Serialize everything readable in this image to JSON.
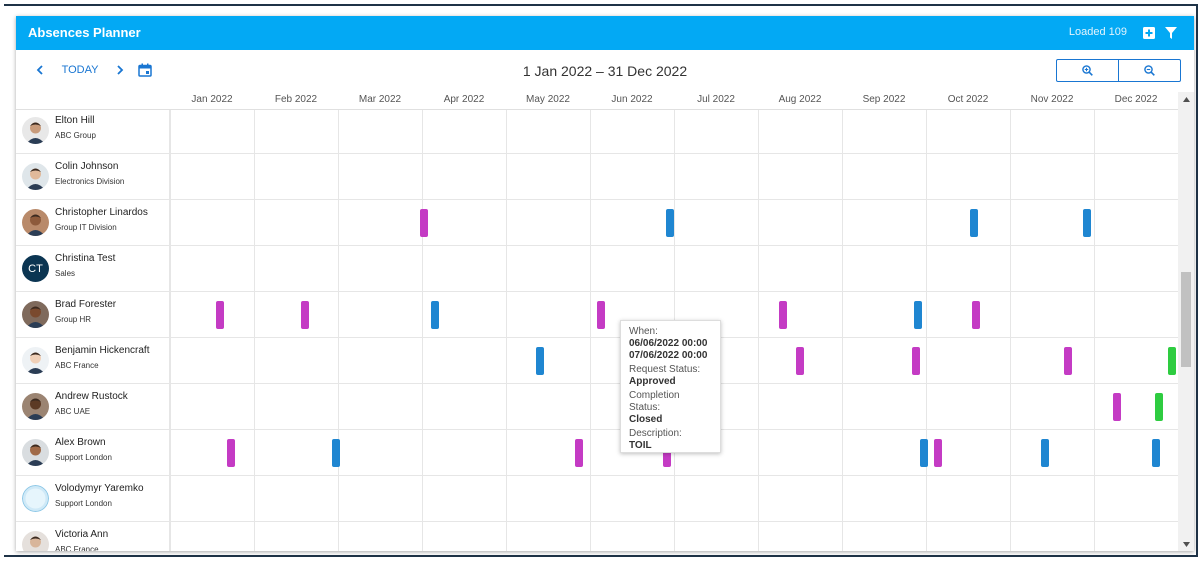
{
  "app": {
    "title": "Absences Planner",
    "loaded_text": "Loaded 109"
  },
  "toolbar": {
    "today_label": "TODAY",
    "date_range": "1 Jan 2022 – 31 Dec 2022"
  },
  "months": [
    "Jan 2022",
    "Feb 2022",
    "Mar 2022",
    "Apr 2022",
    "May 2022",
    "Jun 2022",
    "Jul 2022",
    "Aug 2022",
    "Sep 2022",
    "Oct 2022",
    "Nov 2022",
    "Dec 2022"
  ],
  "colors": {
    "header": "#03a9f4",
    "accent": "#1976d2",
    "magenta": "#c43bc4",
    "blue": "#1f86d1",
    "green": "#2ecc40"
  },
  "people": [
    {
      "name": "Elton Hill",
      "group": "ABC Group",
      "avatar": "photo"
    },
    {
      "name": "Colin Johnson",
      "group": "Electronics Division",
      "avatar": "photo"
    },
    {
      "name": "Christopher Linardos",
      "group": "Group IT Division",
      "avatar": "photo"
    },
    {
      "name": "Christina Test",
      "group": "Sales",
      "avatar": "initials",
      "initials": "CT"
    },
    {
      "name": "Brad Forester",
      "group": "Group HR",
      "avatar": "photo"
    },
    {
      "name": "Benjamin Hickencraft",
      "group": "ABC France",
      "avatar": "photo"
    },
    {
      "name": "Andrew Rustock",
      "group": "ABC UAE",
      "avatar": "photo"
    },
    {
      "name": "Alex Brown",
      "group": "Support London",
      "avatar": "photo"
    },
    {
      "name": "Volodymyr Yaremko",
      "group": "Support London",
      "avatar": "placeholder"
    },
    {
      "name": "Victoria Ann",
      "group": "ABC France",
      "avatar": "photo"
    }
  ],
  "absences": [
    {
      "row": 2,
      "date": "2022-04-03",
      "color": "magenta"
    },
    {
      "row": 2,
      "date": "2022-07-01",
      "color": "blue"
    },
    {
      "row": 2,
      "date": "2022-10-19",
      "color": "blue"
    },
    {
      "row": 2,
      "date": "2022-11-29",
      "color": "blue"
    },
    {
      "row": 4,
      "date": "2022-01-19",
      "color": "magenta"
    },
    {
      "row": 4,
      "date": "2022-02-19",
      "color": "magenta"
    },
    {
      "row": 4,
      "date": "2022-04-07",
      "color": "blue"
    },
    {
      "row": 4,
      "date": "2022-06-06",
      "color": "magenta"
    },
    {
      "row": 4,
      "date": "2022-08-11",
      "color": "magenta"
    },
    {
      "row": 4,
      "date": "2022-09-29",
      "color": "blue"
    },
    {
      "row": 4,
      "date": "2022-10-20",
      "color": "magenta"
    },
    {
      "row": 5,
      "date": "2022-05-15",
      "color": "blue"
    },
    {
      "row": 5,
      "date": "2022-08-17",
      "color": "magenta"
    },
    {
      "row": 5,
      "date": "2022-09-28",
      "color": "magenta"
    },
    {
      "row": 5,
      "date": "2022-11-22",
      "color": "magenta"
    },
    {
      "row": 5,
      "date": "2022-12-30",
      "color": "green"
    },
    {
      "row": 6,
      "date": "2022-12-10",
      "color": "magenta"
    },
    {
      "row": 6,
      "date": "2022-12-25",
      "color": "green"
    },
    {
      "row": 7,
      "date": "2022-01-23",
      "color": "magenta"
    },
    {
      "row": 7,
      "date": "2022-03-02",
      "color": "blue"
    },
    {
      "row": 7,
      "date": "2022-05-29",
      "color": "magenta"
    },
    {
      "row": 7,
      "date": "2022-06-30",
      "color": "magenta"
    },
    {
      "row": 7,
      "date": "2022-10-01",
      "color": "blue"
    },
    {
      "row": 7,
      "date": "2022-10-06",
      "color": "magenta"
    },
    {
      "row": 7,
      "date": "2022-11-14",
      "color": "blue"
    },
    {
      "row": 7,
      "date": "2022-12-24",
      "color": "blue"
    }
  ],
  "tooltip": {
    "when_label": "When:",
    "when_from": "06/06/2022 00:00",
    "when_to": "07/06/2022 00:00",
    "request_status_label": "Request Status:",
    "request_status": "Approved",
    "completion_status_label": "Completion Status:",
    "completion_status": "Closed",
    "description_label": "Description:",
    "description": "TOIL"
  }
}
